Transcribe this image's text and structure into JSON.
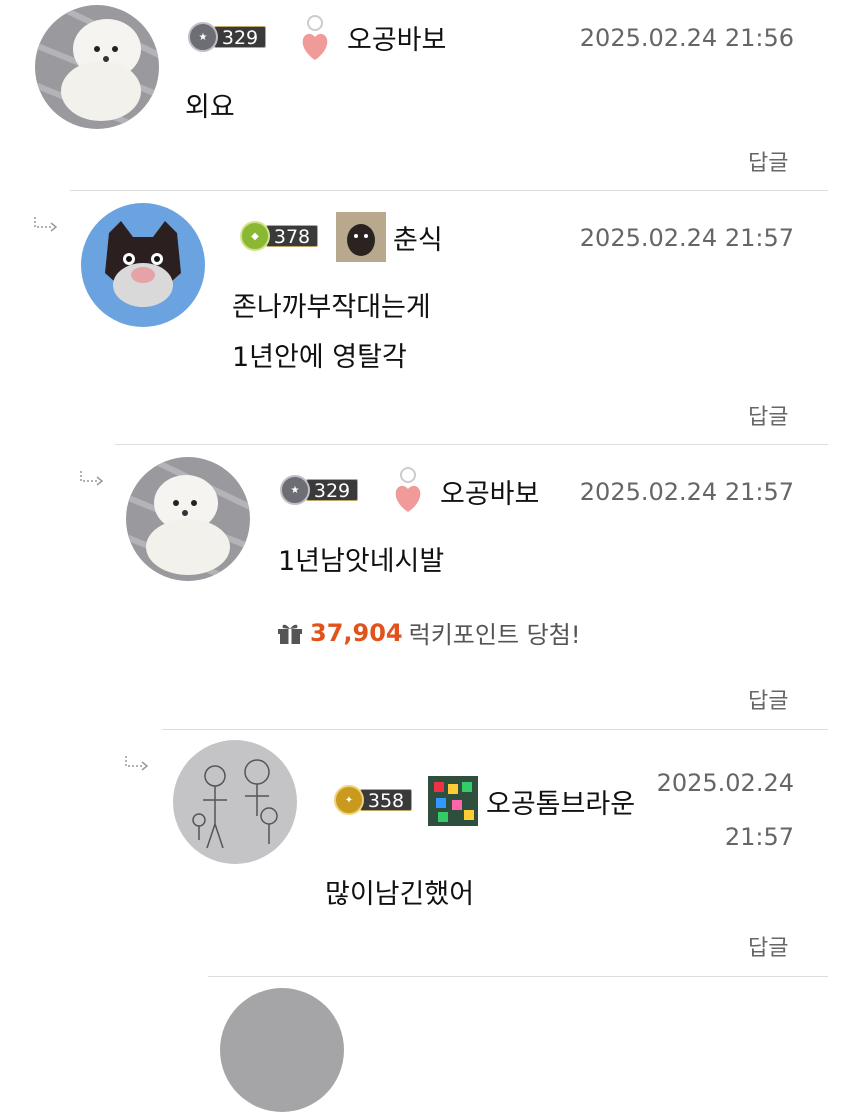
{
  "comments": [
    {
      "nickname": "오공바보",
      "level": "329",
      "date": "2025.02.24 21:56",
      "body": [
        "외요"
      ],
      "reply": "답글",
      "avatar": "white-pomeranian-photo",
      "badge": "pink-heart-icon"
    },
    {
      "nickname": "춘식",
      "level": "378",
      "date": "2025.02.24 21:57",
      "body": [
        "존나까부작대는게",
        "1년안에 영탈각"
      ],
      "reply": "답글",
      "avatar": "black-pomeranian-illustration",
      "badge": "black-dog-photo-icon"
    },
    {
      "nickname": "오공바보",
      "level": "329",
      "date": "2025.02.24 21:57",
      "body": [
        "1년남앗네시발"
      ],
      "lucky_points": "37,904",
      "lucky_text": "럭키포인트 당첨!",
      "reply": "답글",
      "avatar": "white-pomeranian-photo",
      "badge": "pink-heart-icon"
    },
    {
      "nickname": "오공톰브라운",
      "level": "358",
      "date_line1": "2025.02.24",
      "date_line2": "21:57",
      "body": [
        "많이남긴했어"
      ],
      "reply": "답글",
      "avatar": "sketch-family-drawing",
      "badge": "colorful-game-icon"
    }
  ],
  "colors": {
    "lucky_points": "#e0531d",
    "divider": "#dddddd",
    "date": "#666666"
  }
}
